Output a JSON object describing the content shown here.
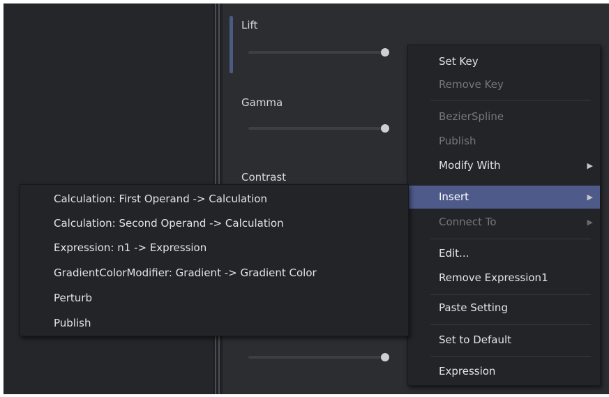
{
  "inspector": {
    "controls": [
      {
        "label": "Lift"
      },
      {
        "label": "Gamma"
      },
      {
        "label": "Contrast"
      }
    ]
  },
  "context_menu": {
    "items": [
      {
        "label": "Set Key",
        "enabled": true
      },
      {
        "label": "Remove Key",
        "enabled": false
      },
      {
        "label": "BezierSpline",
        "enabled": false
      },
      {
        "label": "Publish",
        "enabled": false
      },
      {
        "label": "Modify With",
        "enabled": true,
        "submenu": true
      },
      {
        "label": "Insert",
        "enabled": true,
        "submenu": true,
        "highlighted": true
      },
      {
        "label": "Connect To",
        "enabled": false,
        "submenu": true
      },
      {
        "label": "Edit...",
        "enabled": true
      },
      {
        "label": "Remove Expression1",
        "enabled": true
      },
      {
        "label": "Paste Setting",
        "enabled": true
      },
      {
        "label": "Set to Default",
        "enabled": true
      },
      {
        "label": "Expression",
        "enabled": true
      }
    ],
    "submenu_arrow": "▶"
  },
  "insert_submenu": {
    "items": [
      {
        "label": "Calculation: First Operand -> Calculation"
      },
      {
        "label": "Calculation: Second Operand -> Calculation"
      },
      {
        "label": "Expression: n1 -> Expression"
      },
      {
        "label": "GradientColorModifier: Gradient -> Gradient Color"
      },
      {
        "label": "Perturb"
      },
      {
        "label": "Publish"
      }
    ]
  },
  "colors": {
    "highlight": "#4d5a8a",
    "menu_bg": "#232428",
    "disabled_text": "#76777c"
  }
}
